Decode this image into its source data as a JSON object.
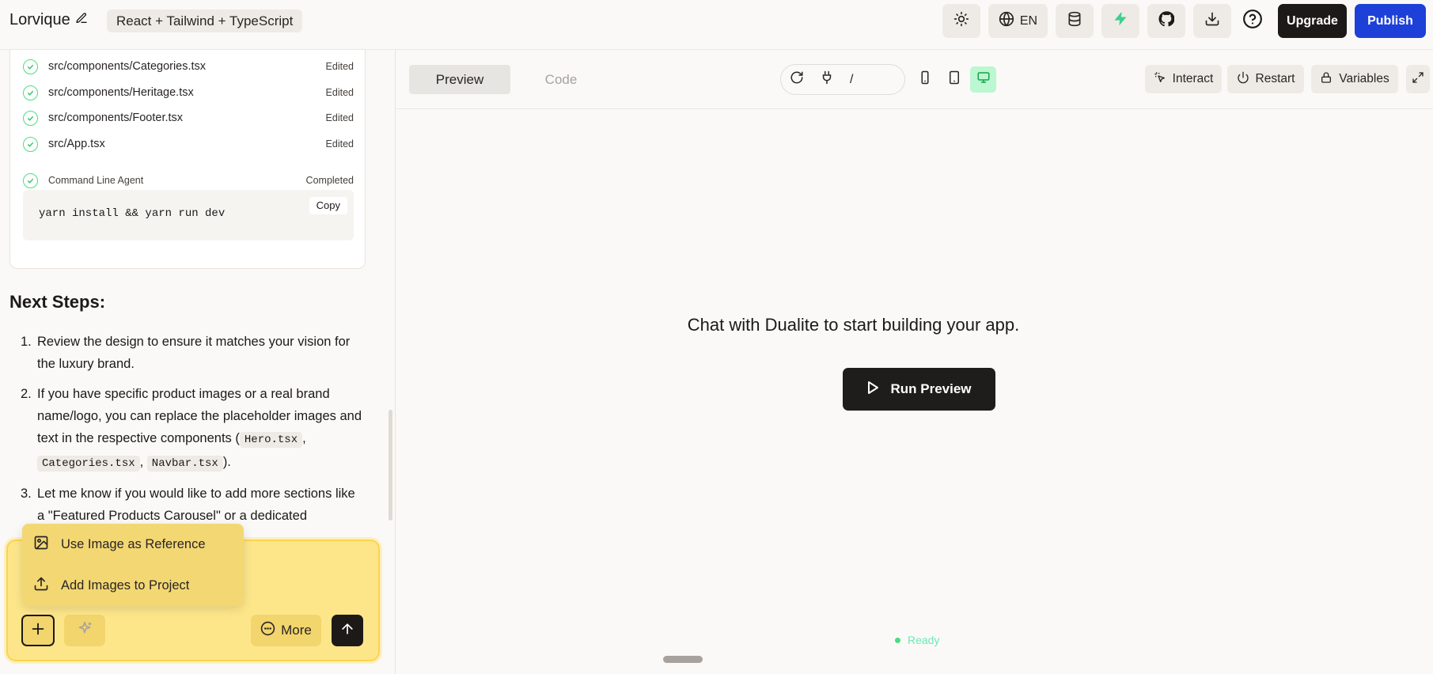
{
  "header": {
    "project_name": "Lorvique",
    "stack": "React + Tailwind + TypeScript",
    "language": "EN",
    "upgrade_label": "Upgrade",
    "publish_label": "Publish",
    "publish_color": "#1d40d8"
  },
  "files": [
    {
      "path": "src/components/Categories.tsx",
      "status": "Edited"
    },
    {
      "path": "src/components/Heritage.tsx",
      "status": "Edited"
    },
    {
      "path": "src/components/Footer.tsx",
      "status": "Edited"
    },
    {
      "path": "src/App.tsx",
      "status": "Edited"
    }
  ],
  "agent": {
    "label": "Command Line Agent",
    "status": "Completed",
    "command": "yarn install && yarn run dev",
    "copy_label": "Copy"
  },
  "next_steps": {
    "title": "Next Steps:",
    "step1": "Review the design to ensure it matches your vision for the luxury brand.",
    "step2_pre": "If you have specific product images or a real brand name/logo, you can replace the placeholder images and text in the respective components (",
    "step2_code1": "Hero.tsx",
    "step2_code2": "Categories.tsx",
    "step2_code3": "Navbar.tsx",
    "step2_post": ").",
    "step3": "Let me know if you would like to add more sections like a \"Featured Products Carousel\" or a dedicated"
  },
  "attach_menu": {
    "item1": "Use Image as Reference",
    "item2": "Add Images to Project"
  },
  "chat_input": {
    "more_label": "More",
    "accent_color": "#fde68a"
  },
  "preview_toolbar": {
    "tab_preview": "Preview",
    "tab_code": "Code",
    "url_path": "/",
    "interact_label": "Interact",
    "restart_label": "Restart",
    "variables_label": "Variables"
  },
  "canvas": {
    "message": "Chat with Dualite to start building your app.",
    "run_label": "Run Preview",
    "status": "Ready"
  }
}
